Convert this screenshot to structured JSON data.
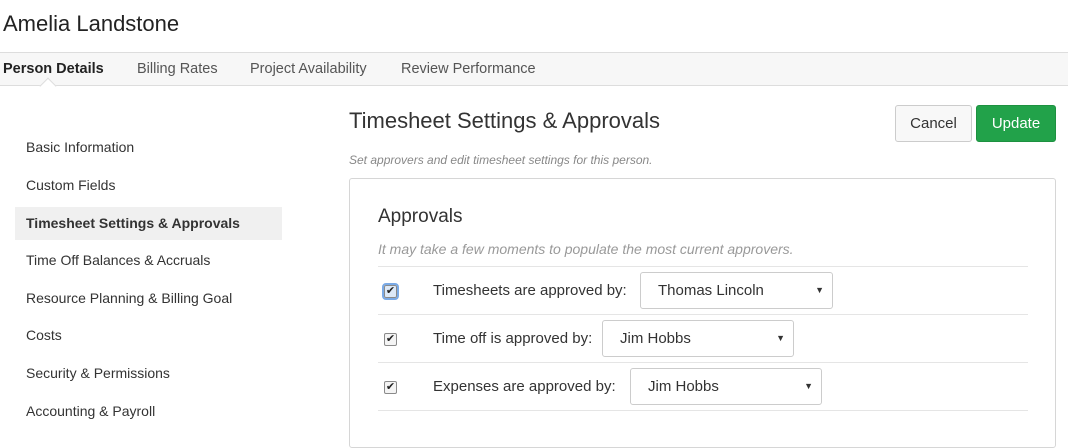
{
  "person_name": "Amelia Landstone",
  "tabs": [
    {
      "label": "Person Details",
      "active": true
    },
    {
      "label": "Billing Rates",
      "active": false
    },
    {
      "label": "Project Availability",
      "active": false
    },
    {
      "label": "Review Performance",
      "active": false
    }
  ],
  "sidebar": {
    "items": [
      {
        "label": "Basic Information"
      },
      {
        "label": "Custom Fields"
      },
      {
        "label": "Timesheet Settings & Approvals",
        "active": true
      },
      {
        "label": "Time Off Balances & Accruals"
      },
      {
        "label": "Resource Planning & Billing Goal"
      },
      {
        "label": "Costs"
      },
      {
        "label": "Security & Permissions"
      },
      {
        "label": "Accounting & Payroll"
      }
    ]
  },
  "main": {
    "title": "Timesheet Settings & Approvals",
    "subtitle": "Set approvers and edit timesheet settings for this person.",
    "cancel_label": "Cancel",
    "update_label": "Update"
  },
  "approvals": {
    "title": "Approvals",
    "note": "It may take a few moments to populate the most current approvers.",
    "rows": [
      {
        "label": "Timesheets are approved by:",
        "checked": true,
        "approver": "Thomas Lincoln"
      },
      {
        "label": "Time off is approved by:",
        "checked": true,
        "approver": "Jim Hobbs"
      },
      {
        "label": "Expenses are approved by:",
        "checked": true,
        "approver": "Jim Hobbs"
      }
    ]
  },
  "colors": {
    "update_button": "#22a24a",
    "active_nav_bg": "#f0f0f0"
  },
  "icons": {
    "check": "checkmark-icon",
    "dropdown": "caret-down-icon"
  }
}
